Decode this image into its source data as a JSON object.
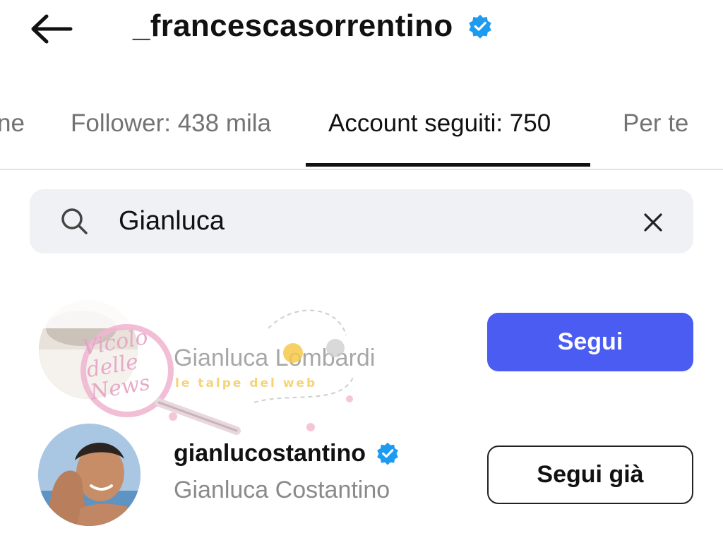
{
  "header": {
    "title": "_francescasorrentino",
    "verified": true,
    "back_icon": "arrow-left-icon"
  },
  "tabs": [
    {
      "label": "ne",
      "active": false
    },
    {
      "label": "Follower: 438 mila",
      "active": false
    },
    {
      "label": "Account seguiti: 750",
      "active": true
    },
    {
      "label": "Per te",
      "active": false
    }
  ],
  "search": {
    "value": "Gianluca",
    "icon": "search-icon",
    "clear_icon": "close-icon"
  },
  "results": [
    {
      "username": "",
      "full_name": "Gianluca Lombardi",
      "verified": false,
      "button_label": "Segui",
      "button_style": "primary"
    },
    {
      "username": "gianlucostantino",
      "full_name": "Gianluca Costantino",
      "verified": true,
      "button_label": "Segui già",
      "button_style": "secondary"
    }
  ],
  "watermark": {
    "logo_text": "Vicolo delle News",
    "tagline": "le talpe del web"
  },
  "colors": {
    "accent": "#4a5cf2",
    "verified": "#1d9bf0",
    "tab_inactive": "#737373",
    "search_bg": "#eff1f4"
  }
}
